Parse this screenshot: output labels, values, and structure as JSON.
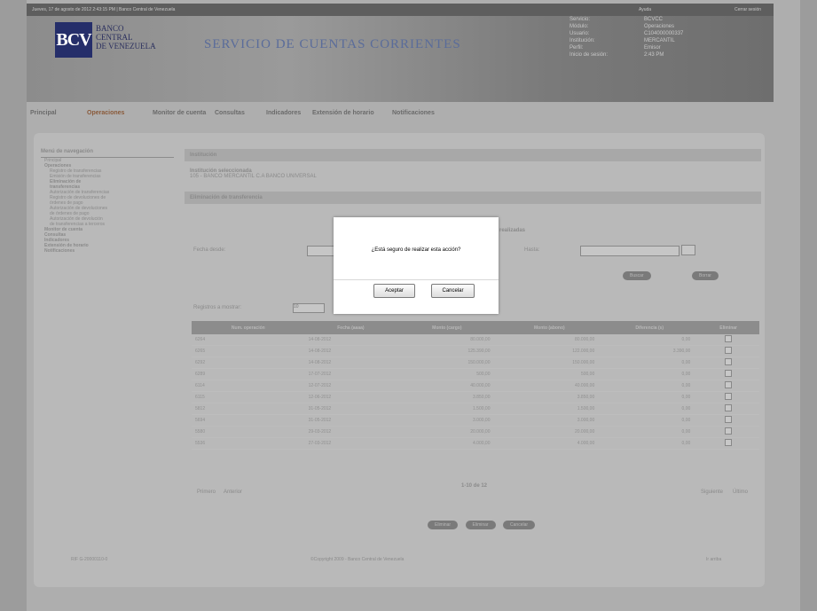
{
  "topbar": {
    "left": "Jueves, 17 de agosto de 2012  2:43:15 PM  |  Banco Central de Venezuela",
    "r1": "Ayuda",
    "r2": "Cerrar sesión"
  },
  "header": {
    "logo": "BCV",
    "bank_lines": [
      "BANCO",
      "CENTRAL",
      "DE VENEZUELA"
    ],
    "service_title": "SERVICIO DE CUENTAS CORRIENTES",
    "info": [
      {
        "k": "Servicio:",
        "v": "BCVCC"
      },
      {
        "k": "Módulo:",
        "v": "Operaciones"
      },
      {
        "k": "Usuario:",
        "v": "C104000000337"
      },
      {
        "k": "Institución:",
        "v": "MERCANTIL"
      },
      {
        "k": "Perfil:",
        "v": "Emisor"
      },
      {
        "k": "Inicio de sesión:",
        "v": "2:43 PM"
      }
    ]
  },
  "nav": [
    "Principal",
    "Operaciones",
    "Monitor de cuenta",
    "Consultas",
    "Indicadores",
    "Extensión de horario",
    "Notificaciones"
  ],
  "menu": {
    "title": "Menú de navegación",
    "items": [
      {
        "t": "Principal",
        "cls": "it"
      },
      {
        "t": "Operaciones",
        "cls": "it b"
      },
      {
        "t": "Registro de transferencias",
        "cls": "it sub"
      },
      {
        "t": "Emisión de transferencias",
        "cls": "it sub"
      },
      {
        "t": "Eliminación de",
        "cls": "it sub b"
      },
      {
        "t": "transferencias",
        "cls": "it sub b"
      },
      {
        "t": "Autorización de transferencias",
        "cls": "it sub"
      },
      {
        "t": "Registro de devoluciones de",
        "cls": "it sub"
      },
      {
        "t": "órdenes de pago",
        "cls": "it sub"
      },
      {
        "t": "Autorización de devoluciones",
        "cls": "it sub"
      },
      {
        "t": "de órdenes de pago",
        "cls": "it sub"
      },
      {
        "t": "Autorización de devolución",
        "cls": "it sub"
      },
      {
        "t": "de transferencias a terceros",
        "cls": "it sub"
      },
      {
        "t": "Monitor de cuenta",
        "cls": "it b"
      },
      {
        "t": "Consultas",
        "cls": "it b"
      },
      {
        "t": "Indicadores",
        "cls": "it b"
      },
      {
        "t": "Extensión de horario",
        "cls": "it b"
      },
      {
        "t": "Notificaciones",
        "cls": "it b"
      }
    ]
  },
  "main": {
    "section": "Institución",
    "inst_label": "Institución seleccionada",
    "inst_value": "105 - BANCO MERCANTIL C.A BANCO UNIVERSAL",
    "subsection": "Eliminación de transferencia",
    "realized": "realizadas",
    "date_from": "Fecha desde:",
    "date_to": "Hasta:",
    "btn_search": "Buscar",
    "btn_clear": "Borrar",
    "records": "Registros a mostrar:",
    "records_value": "10",
    "cols": [
      "Num. operación",
      "Fecha (aaaa)",
      "Monto (cargo)",
      "Monto (abono)",
      "Diferencia (s)",
      "Eliminar"
    ],
    "rows": [
      [
        "6264",
        "14-08-2012",
        "80.000,00",
        "80.000,00",
        "0,00"
      ],
      [
        "6265",
        "14-08-2012",
        "125.390,00",
        "122.000,00",
        "3.390,00"
      ],
      [
        "6292",
        "14-08-2012",
        "150.000,00",
        "150.000,00",
        "0,00"
      ],
      [
        "6289",
        "17-07-2012",
        "500,00",
        "500,00",
        "0,00"
      ],
      [
        "6114",
        "12-07-2012",
        "40.000,00",
        "40.000,00",
        "0,00"
      ],
      [
        "6115",
        "12-06-2012",
        "3.850,00",
        "3.850,00",
        "0,00"
      ],
      [
        "5812",
        "31-05-2012",
        "1.500,00",
        "1.500,00",
        "0,00"
      ],
      [
        "5694",
        "31-05-2012",
        "3.000,00",
        "3.000,00",
        "0,00"
      ],
      [
        "5580",
        "29-03-2012",
        "20.000,00",
        "20.000,00",
        "0,00"
      ],
      [
        "5536",
        "27-03-2012",
        "4.000,00",
        "4.000,00",
        "0,00"
      ]
    ],
    "pager": "1-10 de 12",
    "first": "Primero",
    "prev": "Anterior",
    "next": "Siguiente",
    "last": "Último",
    "actions": [
      "Eliminar",
      "Eliminar",
      "Cancelar"
    ]
  },
  "footer": {
    "left": "RIF G-20000110-0",
    "center": "©Copyright 2009 - Banco Central de Venezuela",
    "right": "Ir arriba"
  },
  "modal": {
    "question": "¿Está seguro de realizar esta acción?",
    "accept": "Aceptar",
    "cancel": "Cancelar"
  }
}
